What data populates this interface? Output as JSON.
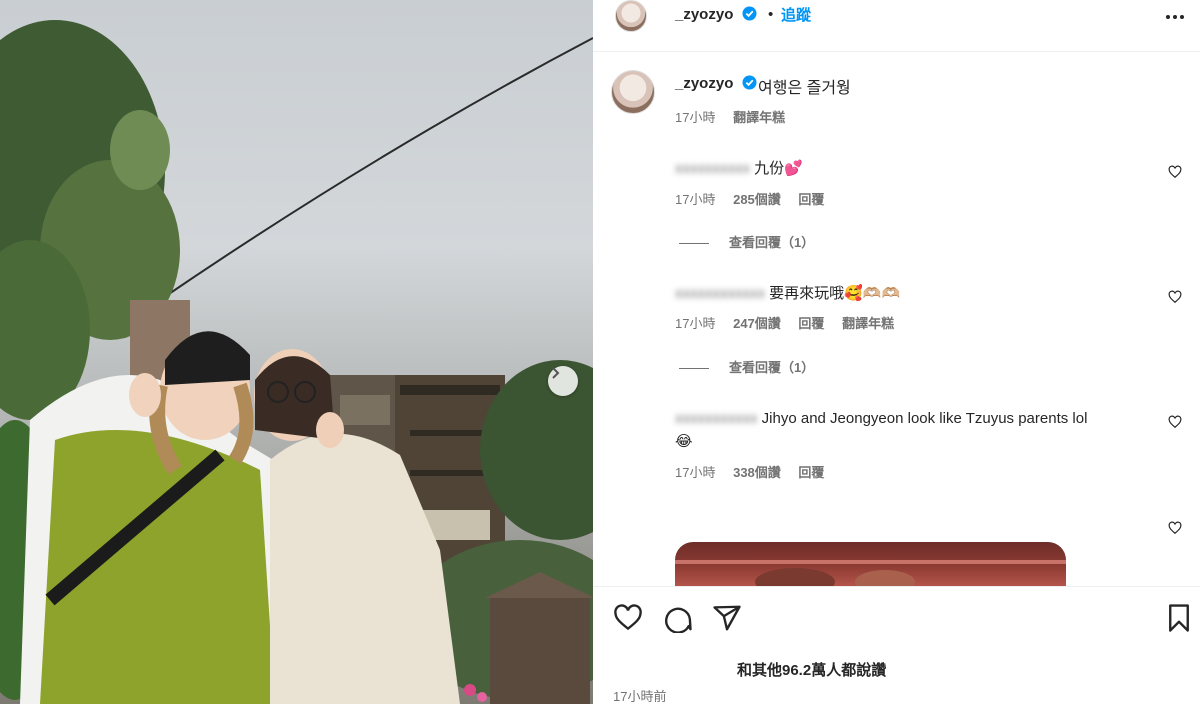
{
  "post": {
    "username": "_zyozyo",
    "dot": "•",
    "follow_label": "追蹤",
    "more_icon": "more-horizontal-icon"
  },
  "caption": {
    "username": "_zyozyo",
    "text": "여행은 즐거웡",
    "time": "17小時",
    "translate": "翻譯年糕"
  },
  "comments": [
    {
      "username": "",
      "text": "九份💕",
      "time": "17小時",
      "likes": "285個讚",
      "reply": "回覆",
      "view_replies": "查看回覆（1）"
    },
    {
      "username": "",
      "text": "要再來玩哦🥰🫶🏼🫶🏼",
      "time": "17小時",
      "likes": "247個讚",
      "reply": "回覆",
      "translate": "翻譯年糕",
      "view_replies": "查看回覆（1）"
    },
    {
      "username": "",
      "text": "Jihyo and Jeongyeon look like Tzuyus parents lol",
      "emoji": "😂",
      "time": "17小時",
      "likes": "338個讚",
      "reply": "回覆"
    }
  ],
  "footer": {
    "likes_text": "和其他96.2萬人都說讚",
    "time_ago": "17小時前"
  },
  "colors": {
    "accent": "#0095f6",
    "text": "#262626",
    "muted": "#737373"
  }
}
